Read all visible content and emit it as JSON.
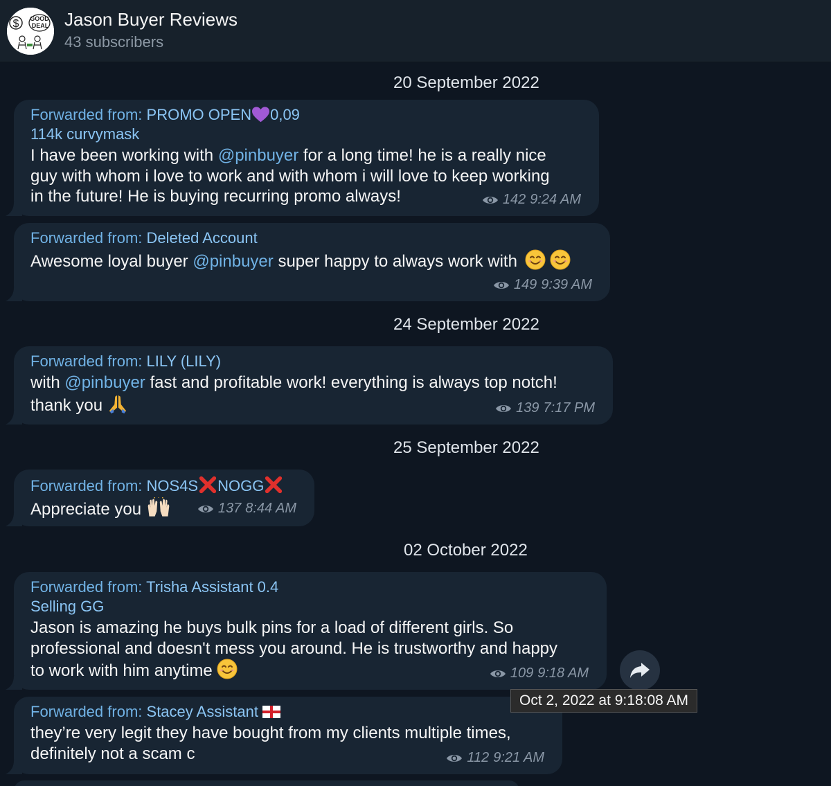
{
  "header": {
    "title": "Jason Buyer Reviews",
    "subtitle": "43 subscribers",
    "avatar_text_top": "GOOD",
    "avatar_text_bottom": "DEAL",
    "avatar_symbol": "$"
  },
  "dates": [
    "20 September 2022",
    "24 September 2022",
    "25 September 2022",
    "02 October 2022"
  ],
  "forward_prefix": "Forwarded from:",
  "messages": [
    {
      "from_line1": "PROMO OPEN",
      "from_line1_suffix": "0,09",
      "from_line2": "114k curvymask",
      "lines": [
        [
          "I have been working with ",
          "@pinbuyer",
          " for a long time! he is a really nice"
        ],
        [
          "guy with whom i love to work and with whom i will love to keep working"
        ],
        [
          "in the future! He is buying recurring promo always!"
        ]
      ],
      "views": "142",
      "time": "9:24 AM"
    },
    {
      "from_line1": "Deleted Account",
      "lines": [
        [
          "Awesome loyal buyer ",
          "@pinbuyer",
          " super happy to always work with"
        ]
      ],
      "views": "149",
      "time": "9:39 AM"
    },
    {
      "from_line1": "LILY (LILY)",
      "lines": [
        [
          "with ",
          "@pinbuyer",
          " fast and profitable work!  everything is always top notch!"
        ],
        [
          "thank you"
        ]
      ],
      "views": "139",
      "time": "7:17 PM"
    },
    {
      "from_line1": "NOS4S",
      "from_line1_mid": "NOGG",
      "lines": [
        [
          "Appreciate you"
        ]
      ],
      "views": "137",
      "time": "8:44 AM"
    },
    {
      "from_line1": "Trisha Assistant 0.4",
      "from_line2": "Selling GG",
      "lines": [
        [
          "Jason is amazing he buys bulk pins for a load of different girls. So"
        ],
        [
          "professional and doesn't mess you around. He is trustworthy and happy"
        ],
        [
          "to work with him anytime"
        ]
      ],
      "views": "109",
      "time": "9:18 AM"
    },
    {
      "from_line1": "Stacey Assistant",
      "lines": [
        [
          "they’re very legit they have bought from my clients multiple times,"
        ],
        [
          "definitely not a scam c"
        ]
      ],
      "views": "112",
      "time": "9:21 AM"
    }
  ],
  "tooltip": "Oct 2, 2022 at 9:18:08 AM",
  "icons": {
    "eye": "eye-icon",
    "share": "share-icon",
    "heart": "purple-heart-emoji",
    "smile": "smiling-face-emoji",
    "pray": "folded-hands-emoji",
    "raise": "raising-hands-emoji",
    "cross": "cross-mark-emoji",
    "flag": "england-flag-emoji"
  },
  "colors": {
    "background": "#0e1621",
    "bubble": "#182533",
    "link": "#71b3e6",
    "meta": "#8a97a6"
  }
}
